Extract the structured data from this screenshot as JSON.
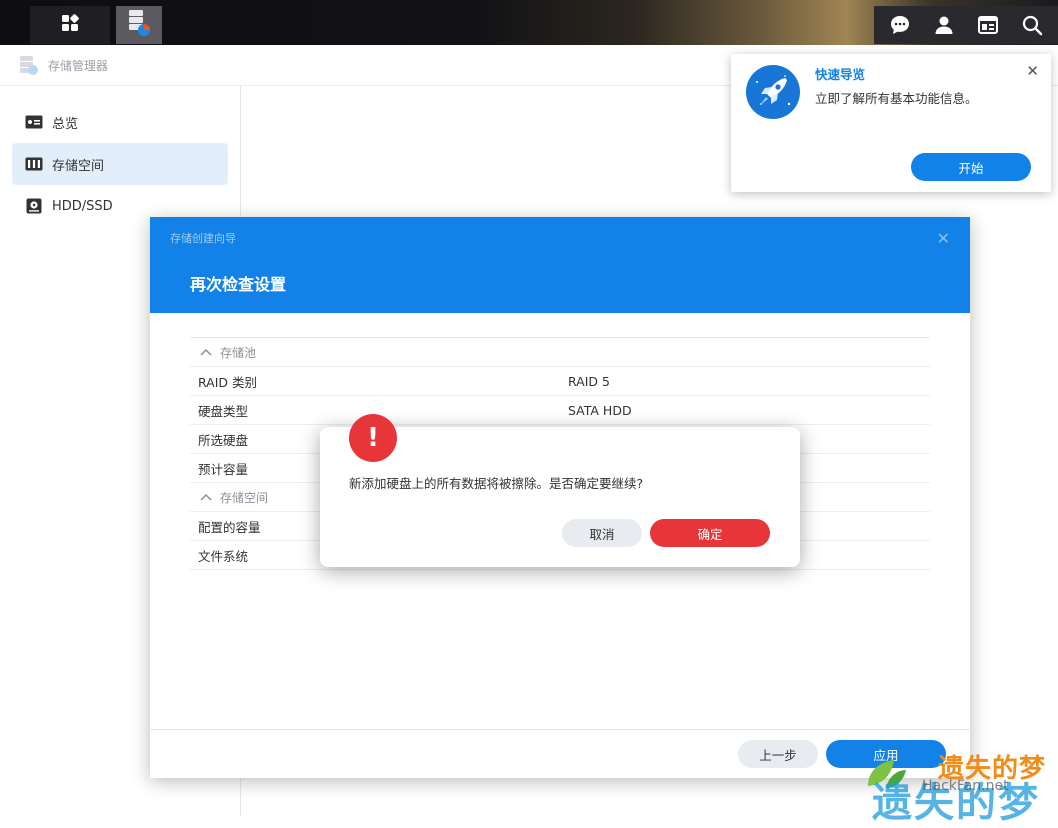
{
  "taskbar": {
    "home_icon": "grid-icon",
    "app_icon": "storage-manager-icon",
    "right_icons": [
      "chat-icon",
      "user-icon",
      "widgets-icon",
      "search-icon"
    ]
  },
  "window": {
    "title": "存储管理器"
  },
  "sidebar": {
    "items": [
      {
        "label": "总览",
        "icon": "overview-icon"
      },
      {
        "label": "存储空间",
        "icon": "storage-volume-icon",
        "active": true
      },
      {
        "label": "HDD/SSD",
        "icon": "disk-icon"
      }
    ]
  },
  "wizard": {
    "small_title": "存储创建向导",
    "title": "再次检查设置",
    "sections": [
      {
        "name": "存储池",
        "rows": [
          {
            "key": "RAID 类别",
            "value": "RAID 5"
          },
          {
            "key": "硬盘类型",
            "value": "SATA HDD"
          },
          {
            "key": "所选硬盘",
            "value": ""
          },
          {
            "key": "预计容量",
            "value": ""
          }
        ]
      },
      {
        "name": "存储空间",
        "rows": [
          {
            "key": "配置的容量",
            "value": ""
          },
          {
            "key": "文件系统",
            "value": ""
          }
        ]
      }
    ],
    "prev_label": "上一步",
    "apply_label": "应用"
  },
  "confirm": {
    "badge": "!",
    "message": "新添加硬盘上的所有数据将被擦除。是否确定要继续?",
    "cancel_label": "取消",
    "ok_label": "确定"
  },
  "guide": {
    "title": "快速导览",
    "description": "立即了解所有基本功能信息。",
    "start_label": "开始"
  },
  "watermark": {
    "line1": "遗失的梦",
    "line2": "遗失的梦",
    "url": "HackFan.net"
  },
  "colors": {
    "accent": "#1282e9",
    "danger": "#e8353a",
    "active_bg": "#e3eefb"
  }
}
